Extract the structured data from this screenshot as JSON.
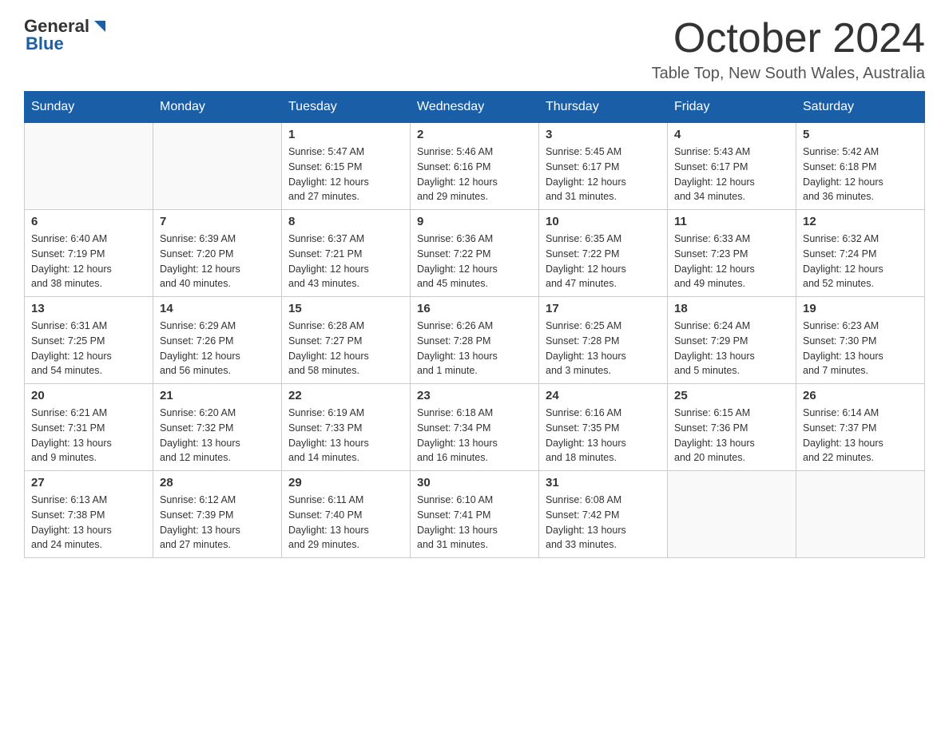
{
  "header": {
    "logo_general": "General",
    "logo_blue": "Blue",
    "month_title": "October 2024",
    "location": "Table Top, New South Wales, Australia"
  },
  "days_of_week": [
    "Sunday",
    "Monday",
    "Tuesday",
    "Wednesday",
    "Thursday",
    "Friday",
    "Saturday"
  ],
  "weeks": [
    [
      {
        "day": "",
        "info": ""
      },
      {
        "day": "",
        "info": ""
      },
      {
        "day": "1",
        "info": "Sunrise: 5:47 AM\nSunset: 6:15 PM\nDaylight: 12 hours\nand 27 minutes."
      },
      {
        "day": "2",
        "info": "Sunrise: 5:46 AM\nSunset: 6:16 PM\nDaylight: 12 hours\nand 29 minutes."
      },
      {
        "day": "3",
        "info": "Sunrise: 5:45 AM\nSunset: 6:17 PM\nDaylight: 12 hours\nand 31 minutes."
      },
      {
        "day": "4",
        "info": "Sunrise: 5:43 AM\nSunset: 6:17 PM\nDaylight: 12 hours\nand 34 minutes."
      },
      {
        "day": "5",
        "info": "Sunrise: 5:42 AM\nSunset: 6:18 PM\nDaylight: 12 hours\nand 36 minutes."
      }
    ],
    [
      {
        "day": "6",
        "info": "Sunrise: 6:40 AM\nSunset: 7:19 PM\nDaylight: 12 hours\nand 38 minutes."
      },
      {
        "day": "7",
        "info": "Sunrise: 6:39 AM\nSunset: 7:20 PM\nDaylight: 12 hours\nand 40 minutes."
      },
      {
        "day": "8",
        "info": "Sunrise: 6:37 AM\nSunset: 7:21 PM\nDaylight: 12 hours\nand 43 minutes."
      },
      {
        "day": "9",
        "info": "Sunrise: 6:36 AM\nSunset: 7:22 PM\nDaylight: 12 hours\nand 45 minutes."
      },
      {
        "day": "10",
        "info": "Sunrise: 6:35 AM\nSunset: 7:22 PM\nDaylight: 12 hours\nand 47 minutes."
      },
      {
        "day": "11",
        "info": "Sunrise: 6:33 AM\nSunset: 7:23 PM\nDaylight: 12 hours\nand 49 minutes."
      },
      {
        "day": "12",
        "info": "Sunrise: 6:32 AM\nSunset: 7:24 PM\nDaylight: 12 hours\nand 52 minutes."
      }
    ],
    [
      {
        "day": "13",
        "info": "Sunrise: 6:31 AM\nSunset: 7:25 PM\nDaylight: 12 hours\nand 54 minutes."
      },
      {
        "day": "14",
        "info": "Sunrise: 6:29 AM\nSunset: 7:26 PM\nDaylight: 12 hours\nand 56 minutes."
      },
      {
        "day": "15",
        "info": "Sunrise: 6:28 AM\nSunset: 7:27 PM\nDaylight: 12 hours\nand 58 minutes."
      },
      {
        "day": "16",
        "info": "Sunrise: 6:26 AM\nSunset: 7:28 PM\nDaylight: 13 hours\nand 1 minute."
      },
      {
        "day": "17",
        "info": "Sunrise: 6:25 AM\nSunset: 7:28 PM\nDaylight: 13 hours\nand 3 minutes."
      },
      {
        "day": "18",
        "info": "Sunrise: 6:24 AM\nSunset: 7:29 PM\nDaylight: 13 hours\nand 5 minutes."
      },
      {
        "day": "19",
        "info": "Sunrise: 6:23 AM\nSunset: 7:30 PM\nDaylight: 13 hours\nand 7 minutes."
      }
    ],
    [
      {
        "day": "20",
        "info": "Sunrise: 6:21 AM\nSunset: 7:31 PM\nDaylight: 13 hours\nand 9 minutes."
      },
      {
        "day": "21",
        "info": "Sunrise: 6:20 AM\nSunset: 7:32 PM\nDaylight: 13 hours\nand 12 minutes."
      },
      {
        "day": "22",
        "info": "Sunrise: 6:19 AM\nSunset: 7:33 PM\nDaylight: 13 hours\nand 14 minutes."
      },
      {
        "day": "23",
        "info": "Sunrise: 6:18 AM\nSunset: 7:34 PM\nDaylight: 13 hours\nand 16 minutes."
      },
      {
        "day": "24",
        "info": "Sunrise: 6:16 AM\nSunset: 7:35 PM\nDaylight: 13 hours\nand 18 minutes."
      },
      {
        "day": "25",
        "info": "Sunrise: 6:15 AM\nSunset: 7:36 PM\nDaylight: 13 hours\nand 20 minutes."
      },
      {
        "day": "26",
        "info": "Sunrise: 6:14 AM\nSunset: 7:37 PM\nDaylight: 13 hours\nand 22 minutes."
      }
    ],
    [
      {
        "day": "27",
        "info": "Sunrise: 6:13 AM\nSunset: 7:38 PM\nDaylight: 13 hours\nand 24 minutes."
      },
      {
        "day": "28",
        "info": "Sunrise: 6:12 AM\nSunset: 7:39 PM\nDaylight: 13 hours\nand 27 minutes."
      },
      {
        "day": "29",
        "info": "Sunrise: 6:11 AM\nSunset: 7:40 PM\nDaylight: 13 hours\nand 29 minutes."
      },
      {
        "day": "30",
        "info": "Sunrise: 6:10 AM\nSunset: 7:41 PM\nDaylight: 13 hours\nand 31 minutes."
      },
      {
        "day": "31",
        "info": "Sunrise: 6:08 AM\nSunset: 7:42 PM\nDaylight: 13 hours\nand 33 minutes."
      },
      {
        "day": "",
        "info": ""
      },
      {
        "day": "",
        "info": ""
      }
    ]
  ]
}
